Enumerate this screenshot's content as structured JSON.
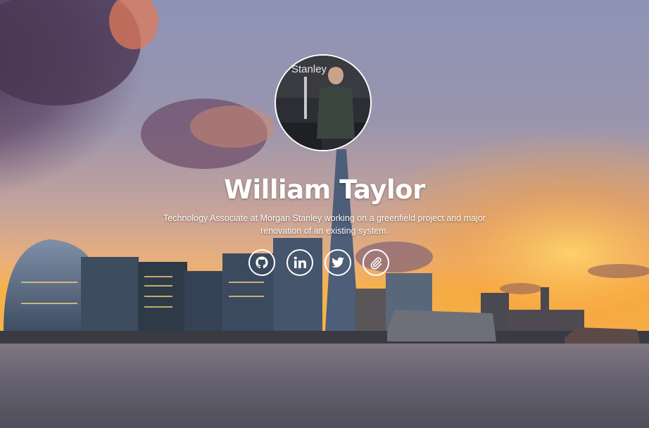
{
  "profile": {
    "name": "William Taylor",
    "tagline": "Technology Associate at Morgan Stanley working on a greenfield project and major renovation of an existing system.",
    "photo_sign_text": "Stanley"
  },
  "social_links": [
    {
      "icon": "github-icon",
      "label": "GitHub"
    },
    {
      "icon": "linkedin-icon",
      "label": "LinkedIn"
    },
    {
      "icon": "twitter-icon",
      "label": "Twitter"
    },
    {
      "icon": "paperclip-icon",
      "label": "Resume"
    }
  ],
  "colors": {
    "text": "#ffffff",
    "sky_top": "#8a8fb0",
    "sunset": "#f4a23a",
    "water": "#6b6a78"
  },
  "background": "London skyline at sunset"
}
